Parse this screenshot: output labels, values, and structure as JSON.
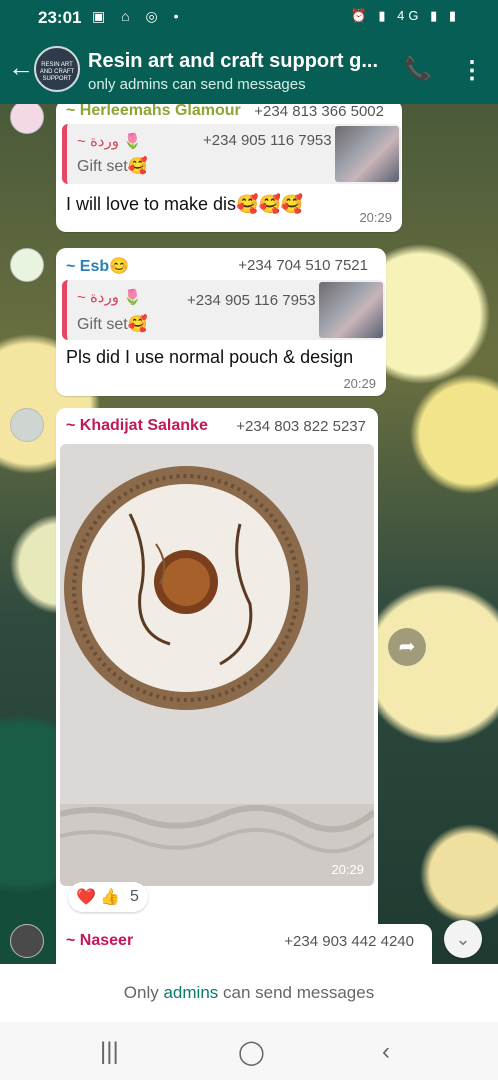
{
  "status_bar": {
    "time": "23:01",
    "left_icons": "▣ ⌂ ◎ •",
    "right_icons": "⏰ ▮ 4G ▮ ▮"
  },
  "header": {
    "back_icon": "arrow-left-icon",
    "title": "Resin art and craft support g...",
    "subtitle": "only admins can send messages",
    "avatar_text": "RESIN ART AND CRAFT SUPPORT",
    "call_icon": "add-call-icon",
    "menu_icon": "more-vert-icon"
  },
  "messages": [
    {
      "sender": "~ Herleemahs Glamour",
      "sender_color": "#8ba634",
      "phone": "+234 813 366 5002",
      "quote": {
        "name": "~ وردة 🌷",
        "phone": "+234 905 116 7953",
        "text": "Gift set🥰"
      },
      "text": "I will love to make dis🥰🥰🥰",
      "time": "20:29"
    },
    {
      "sender": "~ Esb😊",
      "sender_color": "#2c7fb8",
      "phone": "+234 704 510 7521",
      "quote": {
        "name": "~ وردة 🌷",
        "phone": "+234 905 116 7953",
        "text": "Gift set🥰"
      },
      "text": "Pls did I use normal pouch & design",
      "time": "20:29"
    },
    {
      "sender": "~ Khadijat Salanke",
      "sender_color": "#c2185b",
      "phone": "+234 803 822 5237",
      "image_desc": "",
      "time": "20:29",
      "reactions": {
        "emojis": "❤️ 👍",
        "count": "5"
      }
    },
    {
      "sender": "~ Naseer",
      "sender_color": "#c2185b",
      "phone": "+234 903 442 4240"
    }
  ],
  "footer": {
    "prefix": "Only ",
    "link": "admins",
    "suffix": " can send messages"
  },
  "nav_bar": {
    "recents": "|||",
    "home": "◯",
    "back": "‹"
  },
  "colors": {
    "primary": "#075e54",
    "accent": "#0b7a6e"
  }
}
